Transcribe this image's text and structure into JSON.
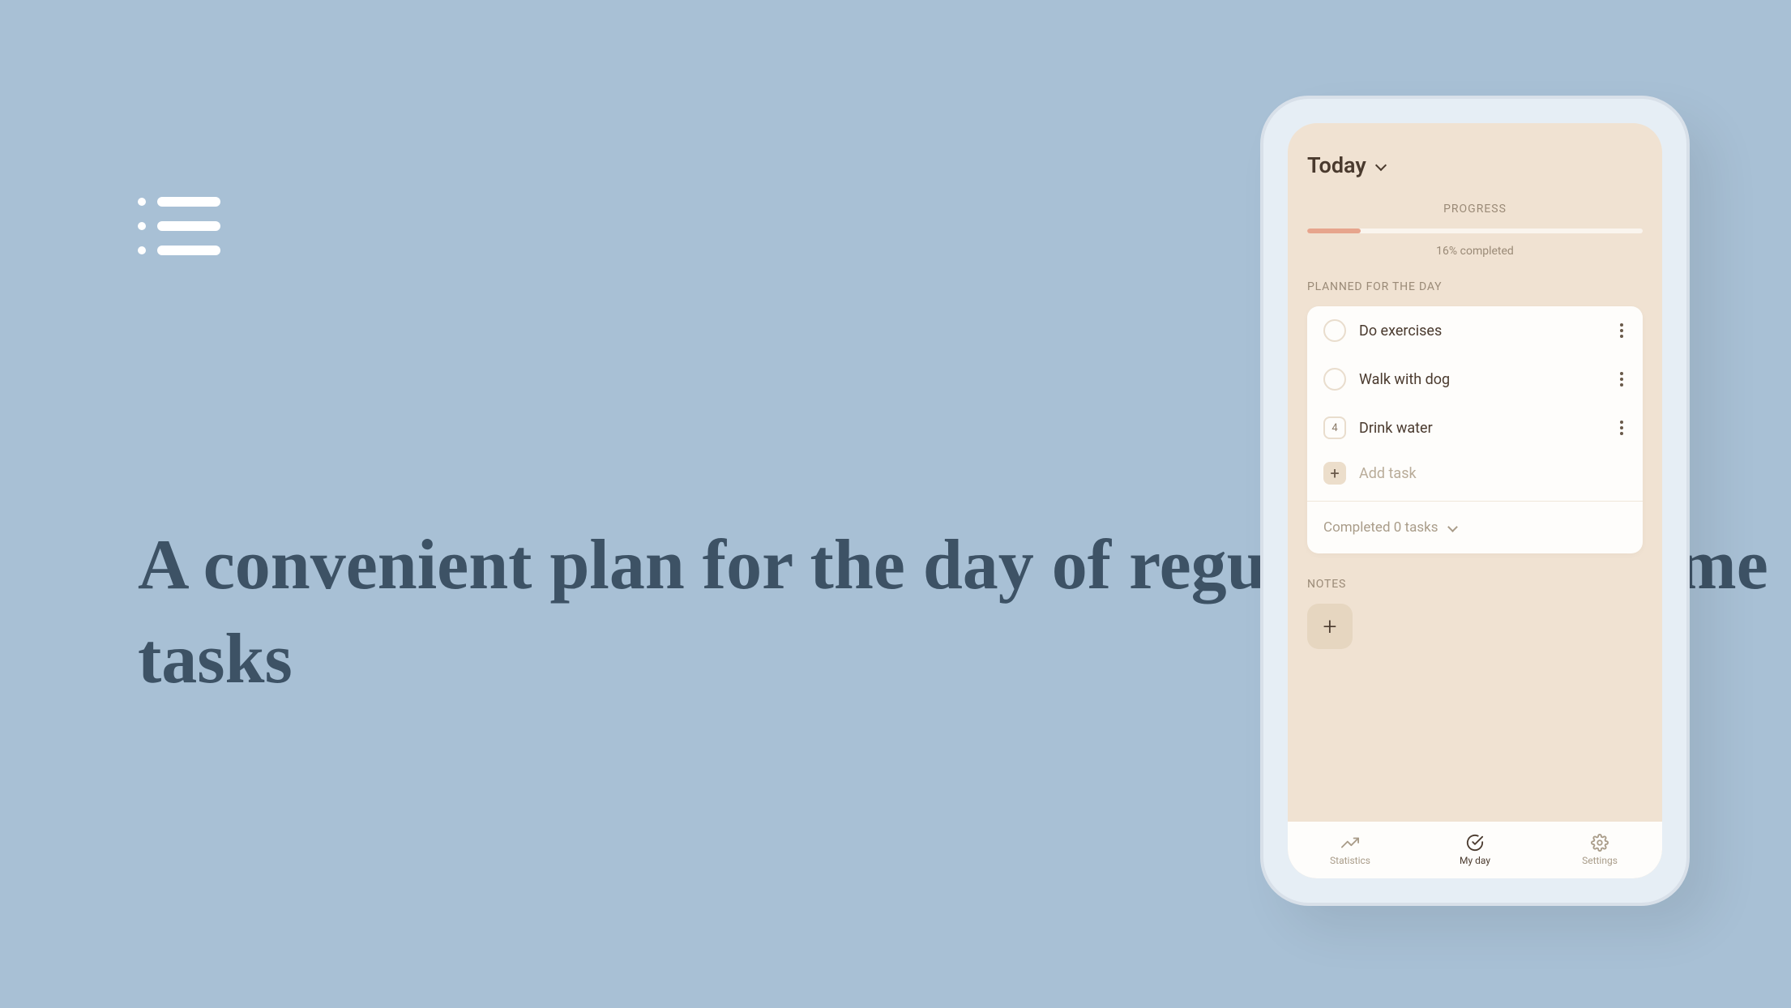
{
  "headline": "A convenient plan for the day of regular and one-time tasks",
  "phone": {
    "header": {
      "title": "Today"
    },
    "progress": {
      "label": "PROGRESS",
      "percent": 16,
      "text": "16% completed"
    },
    "planned": {
      "label": "PLANNED FOR THE DAY",
      "tasks": [
        {
          "label": "Do exercises",
          "type": "circle"
        },
        {
          "label": "Walk with dog",
          "type": "circle"
        },
        {
          "label": "Drink water",
          "type": "counter",
          "count": "4"
        }
      ],
      "add_label": "Add task"
    },
    "completed": {
      "label": "Completed 0 tasks"
    },
    "notes": {
      "label": "NOTES"
    },
    "nav": {
      "statistics": "Statistics",
      "myday": "My day",
      "settings": "Settings"
    }
  }
}
